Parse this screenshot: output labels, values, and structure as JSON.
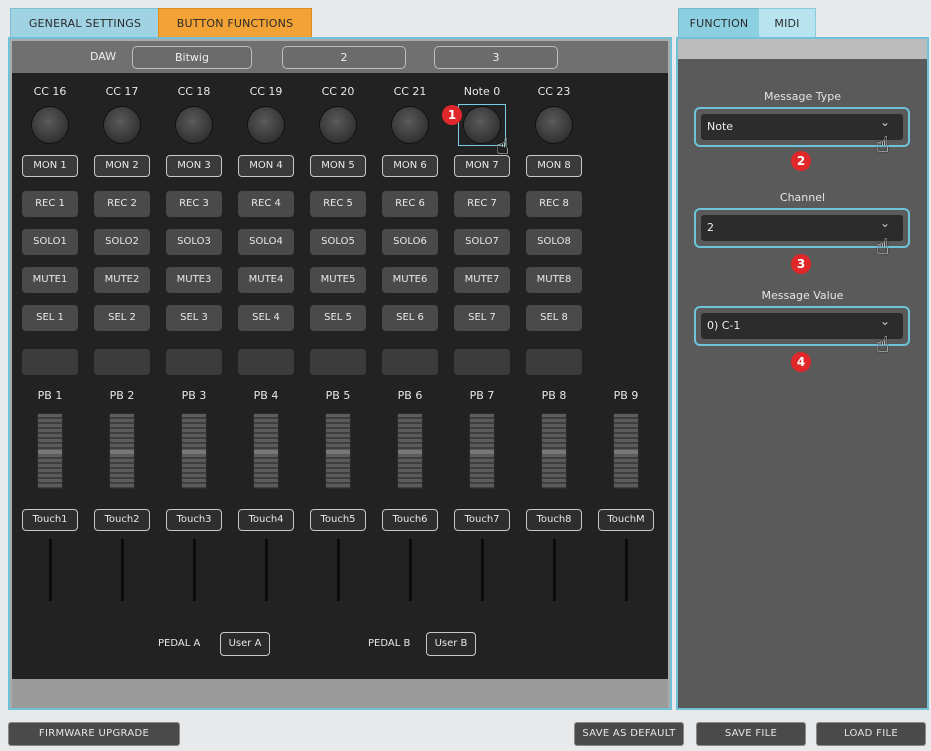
{
  "tabs": {
    "general_settings": "GENERAL SETTINGS",
    "button_functions": "BUTTON FUNCTIONS",
    "function": "FUNCTION",
    "midi": "MIDI"
  },
  "daw": {
    "label": "DAW",
    "slot1": "Bitwig",
    "slot2": "2",
    "slot3": "3"
  },
  "knob_labels": [
    "CC 16",
    "CC 17",
    "CC 18",
    "CC 19",
    "CC 20",
    "CC 21",
    "Note 0",
    "CC 23"
  ],
  "mon_buttons": [
    "MON 1",
    "MON 2",
    "MON 3",
    "MON 4",
    "MON 5",
    "MON 6",
    "MON 7",
    "MON 8"
  ],
  "rec_buttons": [
    "REC 1",
    "REC 2",
    "REC 3",
    "REC 4",
    "REC 5",
    "REC 6",
    "REC 7",
    "REC 8"
  ],
  "solo_buttons": [
    "SOLO1",
    "SOLO2",
    "SOLO3",
    "SOLO4",
    "SOLO5",
    "SOLO6",
    "SOLO7",
    "SOLO8"
  ],
  "mute_buttons": [
    "MUTE1",
    "MUTE2",
    "MUTE3",
    "MUTE4",
    "MUTE5",
    "MUTE6",
    "MUTE7",
    "MUTE8"
  ],
  "sel_buttons": [
    "SEL 1",
    "SEL 2",
    "SEL 3",
    "SEL 4",
    "SEL 5",
    "SEL 6",
    "SEL 7",
    "SEL 8"
  ],
  "pb_labels": [
    "PB 1",
    "PB 2",
    "PB 3",
    "PB 4",
    "PB 5",
    "PB 6",
    "PB 7",
    "PB 8",
    "PB 9"
  ],
  "touch_buttons": [
    "Touch1",
    "Touch2",
    "Touch3",
    "Touch4",
    "Touch5",
    "Touch6",
    "Touch7",
    "Touch8",
    "TouchM"
  ],
  "pedals": {
    "a_label": "PEDAL A",
    "a_value": "User A",
    "b_label": "PEDAL B",
    "b_value": "User B"
  },
  "midi_panel": {
    "message_type_title": "Message Type",
    "message_type_value": "Note",
    "channel_title": "Channel",
    "channel_value": "2",
    "message_value_title": "Message Value",
    "message_value_value": "0)  C-1"
  },
  "badges": [
    "1",
    "2",
    "3",
    "4"
  ],
  "footer": {
    "firmware_upgrade": "FIRMWARE UPGRADE",
    "save_as_default": "SAVE AS DEFAULT",
    "save_file": "SAVE FILE",
    "load_file": "LOAD FILE"
  },
  "colors": {
    "accent_cyan": "#71c1d9",
    "active_tab_orange": "#f3a335",
    "badge_red": "#e0282a"
  }
}
